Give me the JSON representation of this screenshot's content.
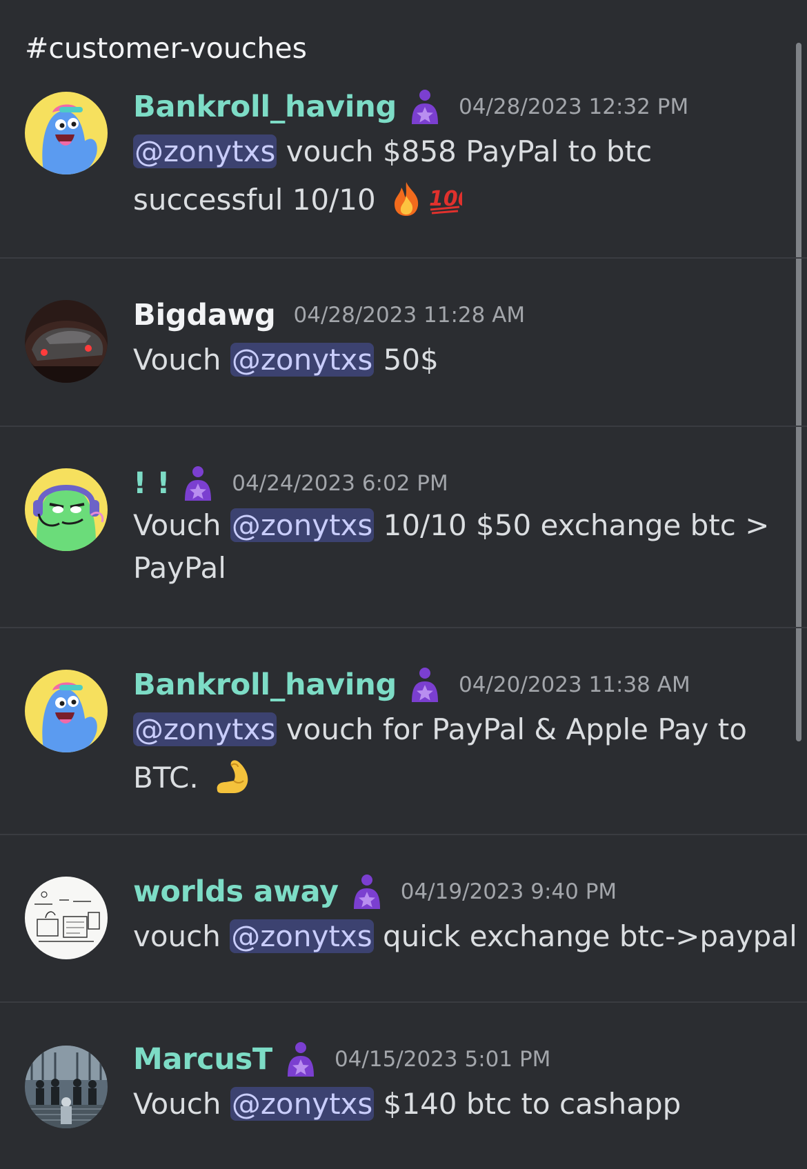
{
  "channel": {
    "title": "#customer-vouches"
  },
  "messages": [
    {
      "username": "Bankroll_having",
      "timestamp": "04/28/2023 12:32 PM",
      "mention": "@zonytxs",
      "text_before": "",
      "text_after": " vouch $858 PayPal to btc successful 10/10 ",
      "emojis": [
        "fire-icon",
        "hundred-points-icon"
      ]
    },
    {
      "username": "Bigdawg",
      "timestamp": "04/28/2023 11:28 AM",
      "text_before": "Vouch ",
      "mention": "@zonytxs",
      "text_after": " 50$"
    },
    {
      "username": "! !",
      "timestamp": "04/24/2023 6:02 PM",
      "text_before": "Vouch ",
      "mention": "@zonytxs",
      "text_after": " 10/10 $50 exchange btc > PayPal"
    },
    {
      "username": "Bankroll_having",
      "timestamp": "04/20/2023 11:38 AM",
      "mention": "@zonytxs",
      "text_before": "",
      "text_after": "  vouch for PayPal & Apple Pay to BTC. ",
      "emojis": [
        "flexed-biceps-icon"
      ]
    },
    {
      "username": "worlds away",
      "timestamp": "04/19/2023 9:40 PM",
      "text_before": "vouch ",
      "mention": "@zonytxs",
      "text_after": " quick exchange btc->paypal"
    },
    {
      "username": "MarcusT",
      "timestamp": "04/15/2023 5:01 PM",
      "text_before": "Vouch ",
      "mention": "@zonytxs",
      "text_after": " $140 btc to cashapp"
    }
  ],
  "colors": {
    "background": "#2b2d31",
    "username_teal": "#7ddcc6",
    "mention_bg": "#3c4270",
    "mention_text": "#c9cdfb",
    "role_icon": "#7b3fd0",
    "timestamp": "#a3a6ab"
  }
}
